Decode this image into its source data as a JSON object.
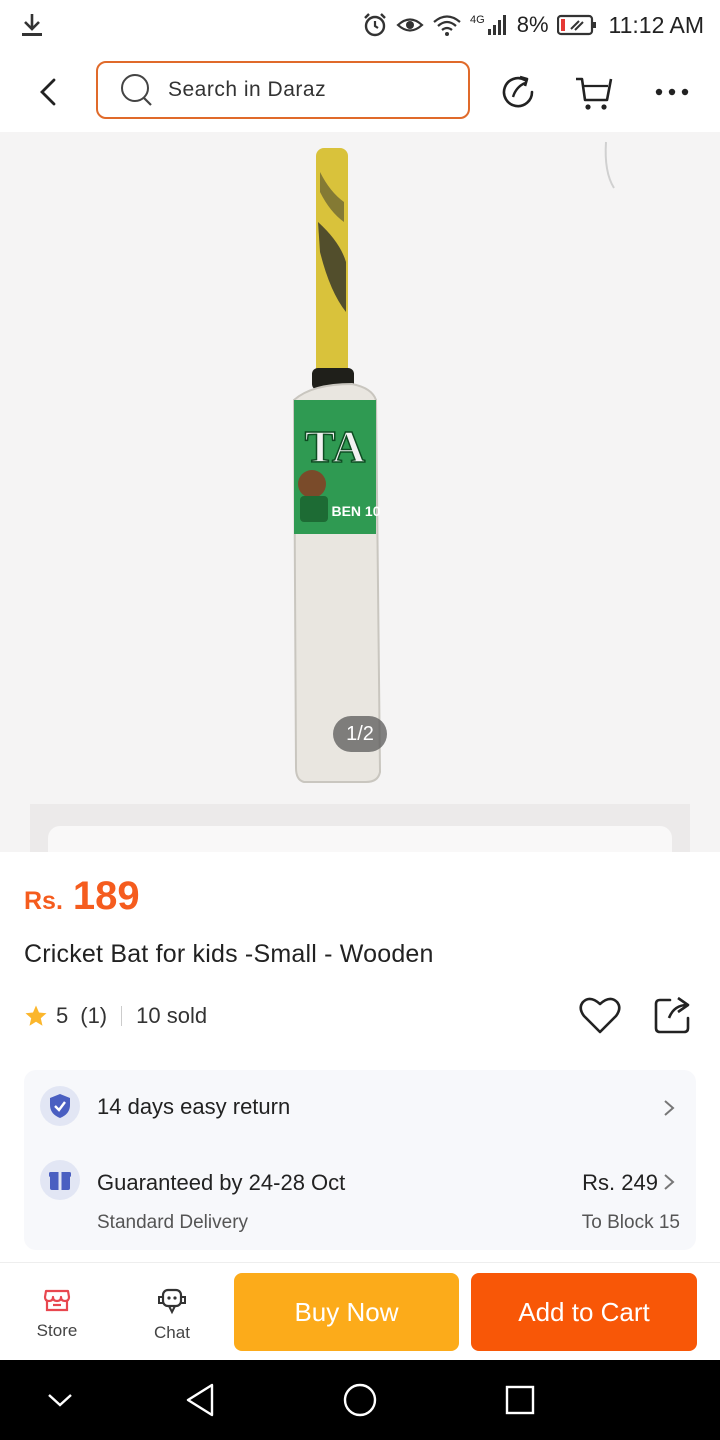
{
  "status_bar": {
    "network": "4G",
    "battery": "8%",
    "time": "11:12 AM"
  },
  "search": {
    "placeholder": "Search in Daraz"
  },
  "gallery": {
    "counter": "1/2",
    "bat_label_text": "TA",
    "bat_sticker_text": "BEN 10"
  },
  "product": {
    "currency": "Rs.",
    "price": "189",
    "title": "Cricket Bat for kids -Small - Wooden",
    "rating": "5",
    "review_count": "(1)",
    "sold": "10 sold"
  },
  "info": {
    "return_policy": "14 days easy return",
    "delivery_guarantee": "Guaranteed by 24-28 Oct",
    "delivery_type": "Standard Delivery",
    "delivery_fee": "Rs. 249",
    "delivery_location": "To Block 15"
  },
  "bottom_bar": {
    "store_label": "Store",
    "chat_label": "Chat",
    "buy_now_label": "Buy Now",
    "add_to_cart_label": "Add to Cart"
  },
  "colors": {
    "accent": "#f55c1e",
    "buy_now": "#fcab1a",
    "add_to_cart": "#f85707",
    "star": "#fbb62c"
  }
}
